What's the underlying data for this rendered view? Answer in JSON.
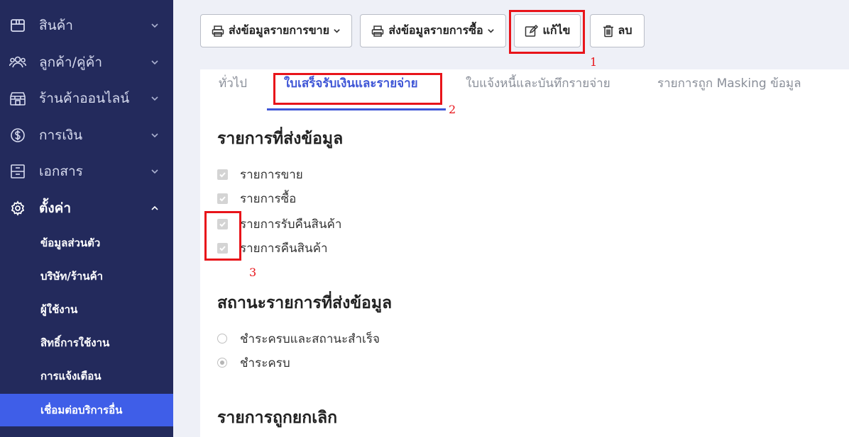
{
  "sidebar": {
    "items": [
      {
        "label": "สินค้า",
        "icon": "box-icon"
      },
      {
        "label": "ลูกค้า/คู่ค้า",
        "icon": "users-icon"
      },
      {
        "label": "ร้านค้าออนไลน์",
        "icon": "store-icon"
      },
      {
        "label": "การเงิน",
        "icon": "dollar-icon"
      },
      {
        "label": "เอกสาร",
        "icon": "archive-icon"
      },
      {
        "label": "ตั้งค่า",
        "icon": "gear-icon"
      }
    ],
    "subitems": [
      {
        "label": "ข้อมูลส่วนตัว"
      },
      {
        "label": "บริษัท/ร้านค้า"
      },
      {
        "label": "ผู้ใช้งาน"
      },
      {
        "label": "สิทธิ์การใช้งาน"
      },
      {
        "label": "การแจ้งเตือน"
      },
      {
        "label": "เชื่อมต่อบริการอื่น"
      }
    ]
  },
  "toolbar": {
    "send_sales_label": "ส่งข้อมูลรายการขาย",
    "send_purchase_label": "ส่งข้อมูลรายการซื้อ",
    "edit_label": "แก้ไข",
    "delete_label": "ลบ"
  },
  "tabs": [
    {
      "label": "ทั่วไป"
    },
    {
      "label": "ใบเสร็จรับเงินและรายจ่าย"
    },
    {
      "label": "ใบแจ้งหนี้และบันทึกรายจ่าย"
    },
    {
      "label": "รายการถูก Masking ข้อมูล"
    }
  ],
  "sections": {
    "send_items_title": "รายการที่ส่งข้อมูล",
    "send_items": [
      {
        "label": "รายการขาย",
        "checked": true
      },
      {
        "label": "รายการซื้อ",
        "checked": true
      },
      {
        "label": "รายการรับคืนสินค้า",
        "checked": true
      },
      {
        "label": "รายการคืนสินค้า",
        "checked": true
      }
    ],
    "status_title": "สถานะรายการที่ส่งข้อมูล",
    "status_options": [
      {
        "label": "ชำระครบและสถานะสำเร็จ",
        "selected": false
      },
      {
        "label": "ชำระครบ",
        "selected": true
      }
    ],
    "cancelled_title": "รายการถูกยกเลิก"
  },
  "annotations": {
    "a1": "1",
    "a2": "2",
    "a3": "3"
  },
  "colors": {
    "sidebar": "#232a5c",
    "accent": "#3f56d6",
    "highlight": "#e8141a"
  }
}
